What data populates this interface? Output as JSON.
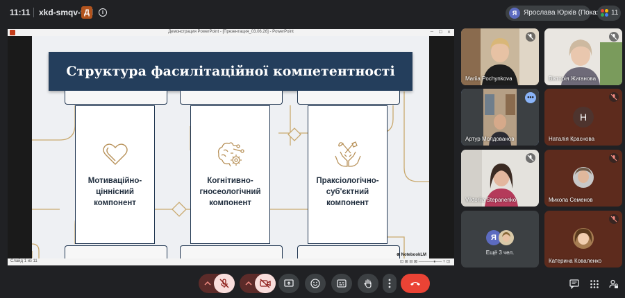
{
  "topbar": {
    "time": "11:11",
    "meeting_code": "xkd-smqv-fyd",
    "badge_letter": "Д",
    "info_icon": "info-icon",
    "presenter_avatar": "Я",
    "presenter_name": "Ярослава Юрків (Показ)",
    "participants_count": "11"
  },
  "window": {
    "title": "Демонстрация PowerPoint - [Презентация_03.06.26] - PowerPoint",
    "status_left": "Слайд 1 из 11",
    "status_right": "⊡ ⊞ ⊟ ⊠ ─────●── + ⊡"
  },
  "slide": {
    "title": "Структура фасилітаційної компетентності",
    "cards": [
      {
        "icon": "heart-icon",
        "label_lines": [
          "Мотиваційно-",
          "ціннісний",
          "компонент"
        ]
      },
      {
        "icon": "brain-gears-icon",
        "label_lines": [
          "Когнітивно-",
          "гносеологічний",
          "компонент"
        ]
      },
      {
        "icon": "hands-tools-icon",
        "label_lines": [
          "Праксіологічно-",
          "суб'єктний",
          "компонент"
        ]
      }
    ],
    "watermark": "⊗ NotebookLM",
    "colors": {
      "banner": "#243e5c",
      "gold": "#c9a96e",
      "background": "#eef0f3"
    }
  },
  "participants": [
    {
      "name": "Mariia Pochynkova",
      "type": "video",
      "muted": true
    },
    {
      "name": "Вікторія Жиганова",
      "type": "video",
      "muted": true
    },
    {
      "name": "Артур Молдованов",
      "type": "video",
      "active": true
    },
    {
      "name": "Наталія Краснова",
      "type": "initial",
      "initial": "Н",
      "muted": true
    },
    {
      "name": "Viktoriia Stepanenko",
      "type": "video",
      "muted": true
    },
    {
      "name": "Микола Семенов",
      "type": "photo",
      "muted": true
    },
    {
      "name": "Ещё 3 чел.",
      "type": "more",
      "avatar": "Я"
    },
    {
      "name": "Катерина Коваленко",
      "type": "photo",
      "muted": true
    }
  ],
  "controls": {
    "mic": "mic-off-icon",
    "camera": "camera-off-icon",
    "present": "present-icon",
    "emoji": "emoji-icon",
    "captions": "captions-icon",
    "raise_hand": "raise-hand-icon",
    "more": "more-vert-icon",
    "end_call": "end-call-icon",
    "chat": "chat-icon",
    "activities": "apps-icon",
    "host_controls": "host-lock-icon"
  }
}
